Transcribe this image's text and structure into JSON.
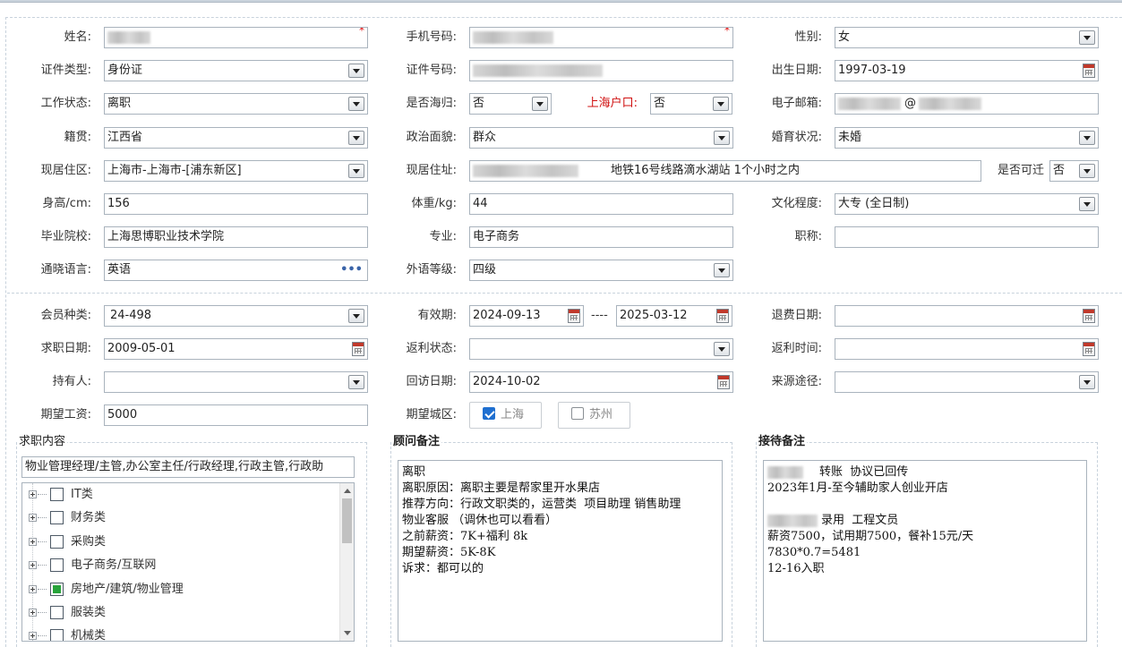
{
  "fields": {
    "name": {
      "label": "姓名:"
    },
    "phone": {
      "label": "手机号码:"
    },
    "gender": {
      "label": "性别:",
      "value": "女"
    },
    "id_type": {
      "label": "证件类型:",
      "value": "身份证"
    },
    "id_number": {
      "label": "证件号码:"
    },
    "birth_date": {
      "label": "出生日期:",
      "value": "1997-03-19"
    },
    "work_status": {
      "label": "工作状态:",
      "value": "离职"
    },
    "returnee": {
      "label": "是否海归:",
      "value": "否"
    },
    "shanghai_hukou": {
      "label": "上海户口:",
      "value": "否"
    },
    "email": {
      "label": "电子邮箱:",
      "value": "@"
    },
    "native_place": {
      "label": "籍贯:",
      "value": "江西省"
    },
    "political_status": {
      "label": "政治面貌:",
      "value": "群众"
    },
    "marital_status": {
      "label": "婚育状况:",
      "value": "未婚"
    },
    "residence_area": {
      "label": "现居住区:",
      "value": "上海市-上海市-[浦东新区]"
    },
    "residence_address": {
      "label": "现居住址:",
      "value": "地铁16号线路滴水湖站 1个小时之内"
    },
    "relocatable": {
      "label": "是否可迁",
      "value": "否"
    },
    "height": {
      "label": "身高/cm:",
      "value": "156"
    },
    "weight": {
      "label": "体重/kg:",
      "value": "44"
    },
    "education": {
      "label": "文化程度:",
      "value": "大专 (全日制)"
    },
    "school": {
      "label": "毕业院校:",
      "value": "上海思博职业技术学院"
    },
    "major": {
      "label": "专业:",
      "value": "电子商务"
    },
    "title": {
      "label": "职称:",
      "value": ""
    },
    "language": {
      "label": "通晓语言:",
      "value": "英语"
    },
    "language_level": {
      "label": "外语等级:",
      "value": "四级"
    },
    "member_type": {
      "label": "会员种类:",
      "value": "24-498"
    },
    "valid_period": {
      "label": "有效期:",
      "start": "2024-09-13",
      "separator": "----",
      "end": "2025-03-12"
    },
    "refund_date": {
      "label": "退费日期:",
      "value": ""
    },
    "job_seek_date": {
      "label": "求职日期:",
      "value": "2009-05-01"
    },
    "rebate_status": {
      "label": "返利状态:",
      "value": ""
    },
    "rebate_time": {
      "label": "返利时间:",
      "value": ""
    },
    "holder": {
      "label": "持有人:",
      "value": ""
    },
    "visit_date": {
      "label": "回访日期:",
      "value": "2024-10-02"
    },
    "source": {
      "label": "来源途径:",
      "value": ""
    },
    "expected_salary": {
      "label": "期望工资:",
      "value": "5000"
    },
    "expected_city": {
      "label": "期望城区:",
      "options": [
        {
          "label": "上海",
          "checked": true
        },
        {
          "label": "苏州",
          "checked": false
        }
      ]
    }
  },
  "job_content": {
    "title": "求职内容",
    "summary": "物业管理经理/主管,办公室主任/行政经理,行政主管,行政助",
    "tree": [
      {
        "label": "IT类",
        "state": "unchecked"
      },
      {
        "label": "财务类",
        "state": "unchecked"
      },
      {
        "label": "采购类",
        "state": "unchecked"
      },
      {
        "label": "电子商务/互联网",
        "state": "unchecked"
      },
      {
        "label": "房地产/建筑/物业管理",
        "state": "partial"
      },
      {
        "label": "服装类",
        "state": "unchecked"
      },
      {
        "label": "机械类",
        "state": "unchecked"
      }
    ]
  },
  "consultant_notes": {
    "title": "顾问备注",
    "lines": [
      "离职",
      "离职原因：离职主要是帮家里开水果店",
      "推荐方向：行政文职类的，运营类  项目助理 销售助理",
      "物业客服 （调休也可以看看）",
      "之前薪资：7K+福利 8k",
      "期望薪资：5K-8K",
      "诉求：都可以的"
    ]
  },
  "reception_notes": {
    "title": "接待备注",
    "lines": [
      "转账  协议已回传",
      "2023年1月-至今辅助家人创业开店",
      "",
      "录用  工程文员",
      "薪资7500，试用期7500，餐补15元/天",
      "7830*0.7=5481",
      "12-16入职"
    ]
  },
  "colors": {
    "border": "#a9b3bd",
    "accent_red": "#d01010",
    "checkbox_blue": "#1f6fd0",
    "tree_partial_green": "#27a33a"
  },
  "icons": {
    "dropdown": "chevron-down-icon",
    "calendar": "calendar-icon",
    "more": "more-dots-icon"
  }
}
